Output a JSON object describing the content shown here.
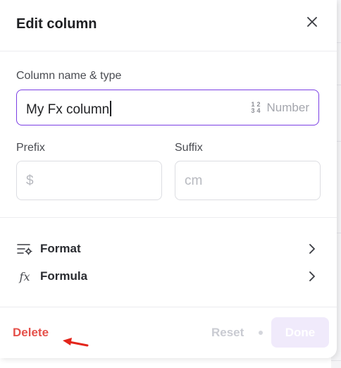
{
  "dialog": {
    "title": "Edit column",
    "close_icon": "close-icon"
  },
  "column": {
    "section_label": "Column name & type",
    "name_value": "My Fx column",
    "type_label": "Number",
    "type_icon": "number-type-icon",
    "type_icon_digits": [
      "1",
      "2",
      "3",
      "4"
    ]
  },
  "prefix": {
    "label": "Prefix",
    "placeholder": "$"
  },
  "suffix": {
    "label": "Suffix",
    "placeholder": "cm"
  },
  "options": [
    {
      "label": "Format",
      "icon": "format-settings-icon"
    },
    {
      "label": "Formula",
      "icon": "formula-fx-icon",
      "icon_text": "fx"
    }
  ],
  "footer": {
    "delete_label": "Delete",
    "reset_label": "Reset",
    "done_label": "Done"
  },
  "colors": {
    "accent": "#7b3fe4",
    "danger": "#e5504a",
    "annotation_arrow": "#e3251b"
  }
}
